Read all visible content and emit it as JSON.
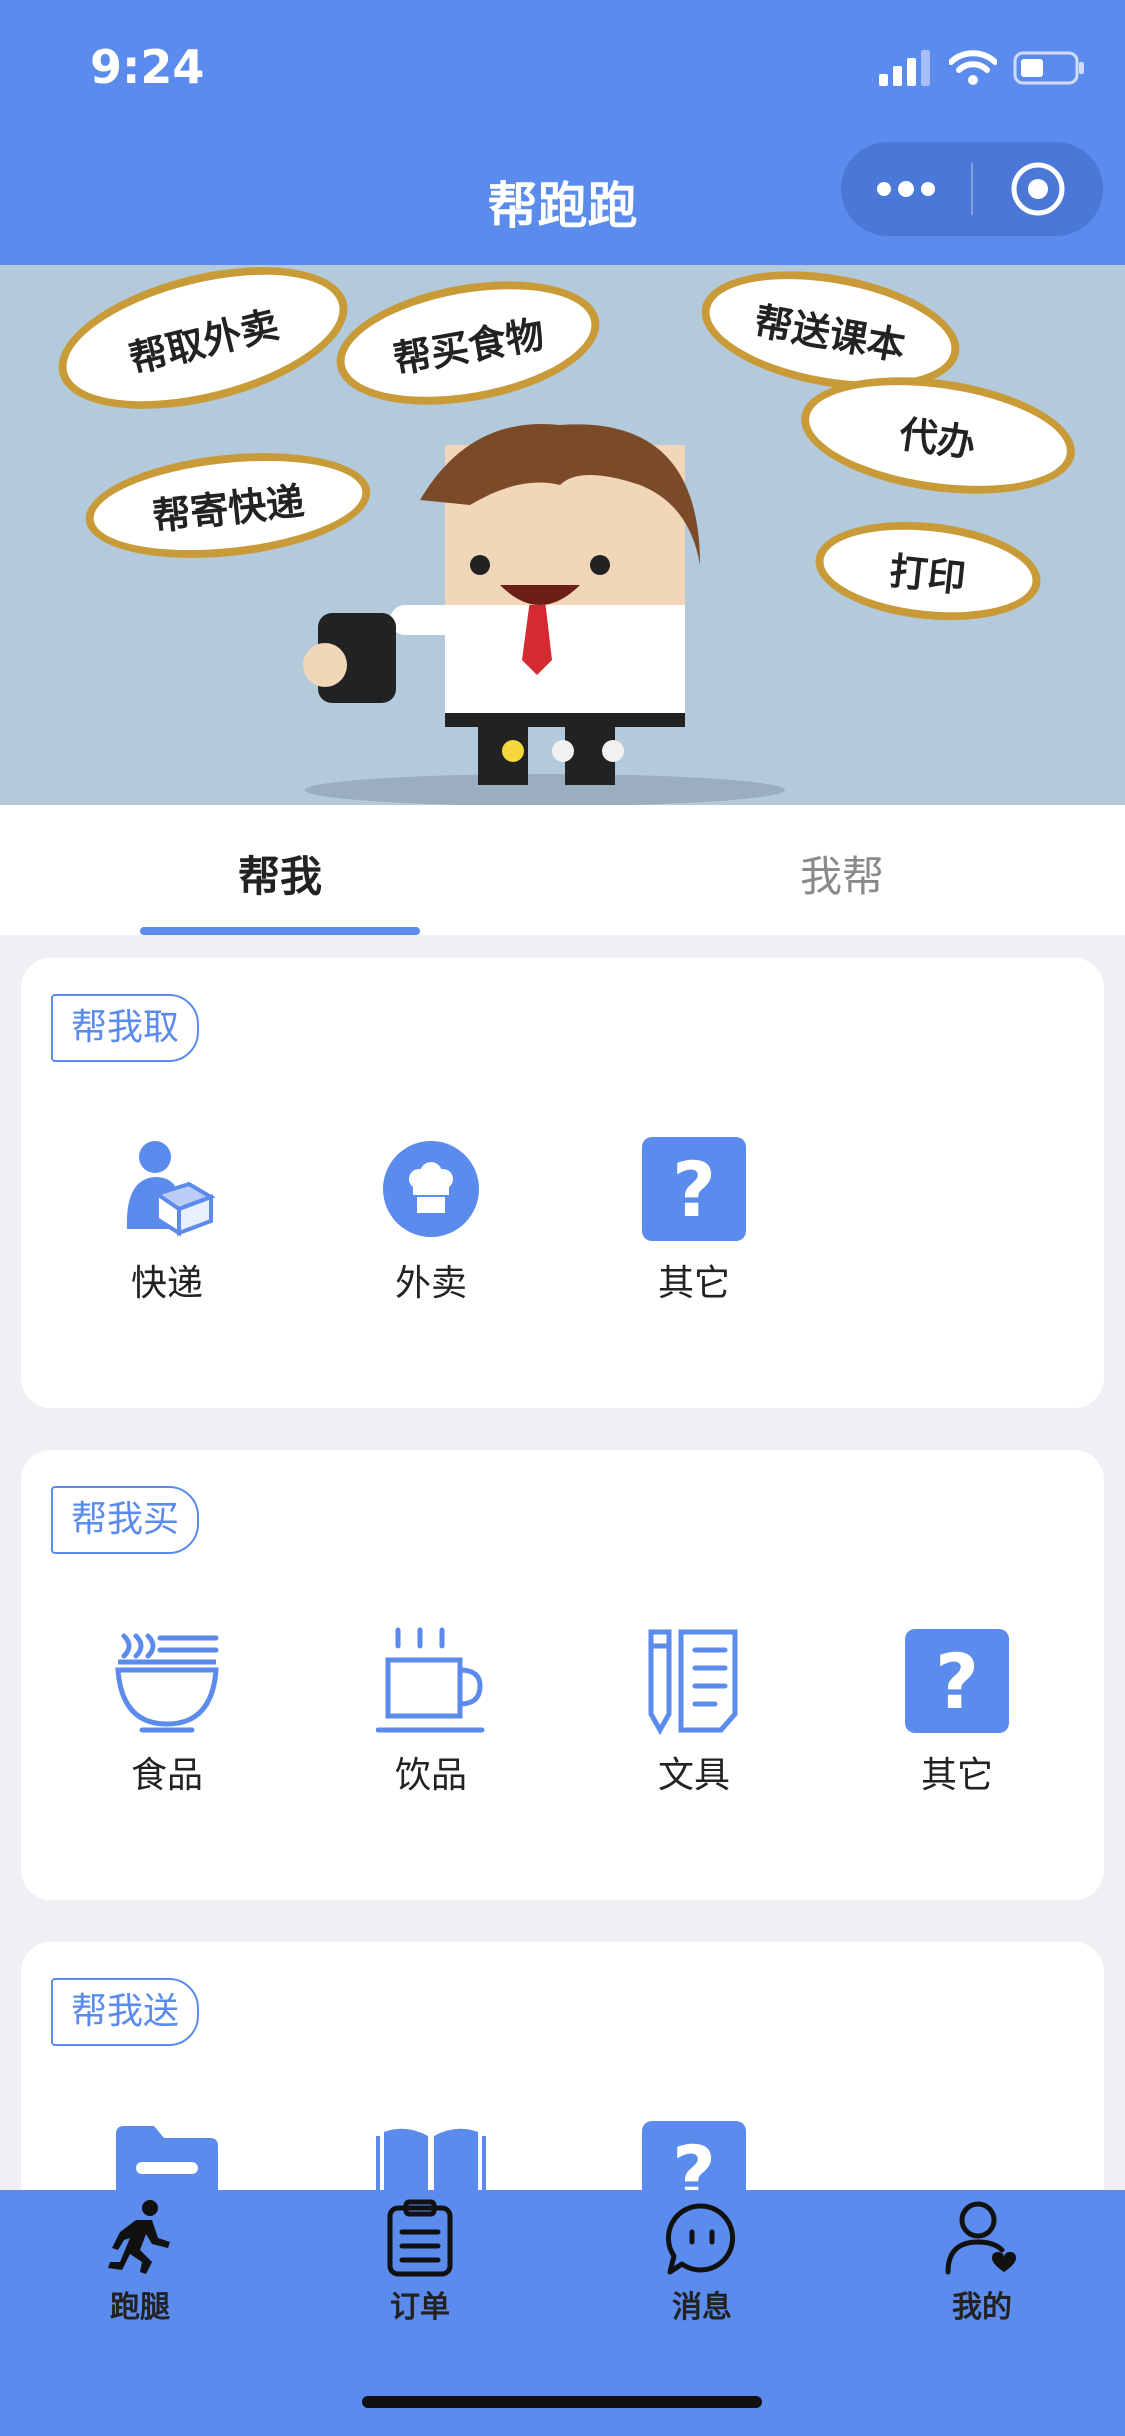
{
  "status": {
    "time": "9:24"
  },
  "nav": {
    "title": "帮跑跑"
  },
  "banner": {
    "bubbles": [
      "帮取外卖",
      "帮买食物",
      "帮送课本",
      "代办",
      "帮寄快递",
      "打印"
    ]
  },
  "tabs": {
    "left": "帮我",
    "right": "我帮"
  },
  "sections": {
    "take": {
      "tag": "帮我取",
      "items": [
        "快递",
        "外卖",
        "其它"
      ]
    },
    "buy": {
      "tag": "帮我买",
      "items": [
        "食品",
        "饮品",
        "文具",
        "其它"
      ]
    },
    "send": {
      "tag": "帮我送"
    }
  },
  "tabbar": {
    "items": [
      "跑腿",
      "订单",
      "消息",
      "我的"
    ]
  },
  "colors": {
    "accent": "#5b8bec",
    "active_dot": "#f4d83c"
  }
}
